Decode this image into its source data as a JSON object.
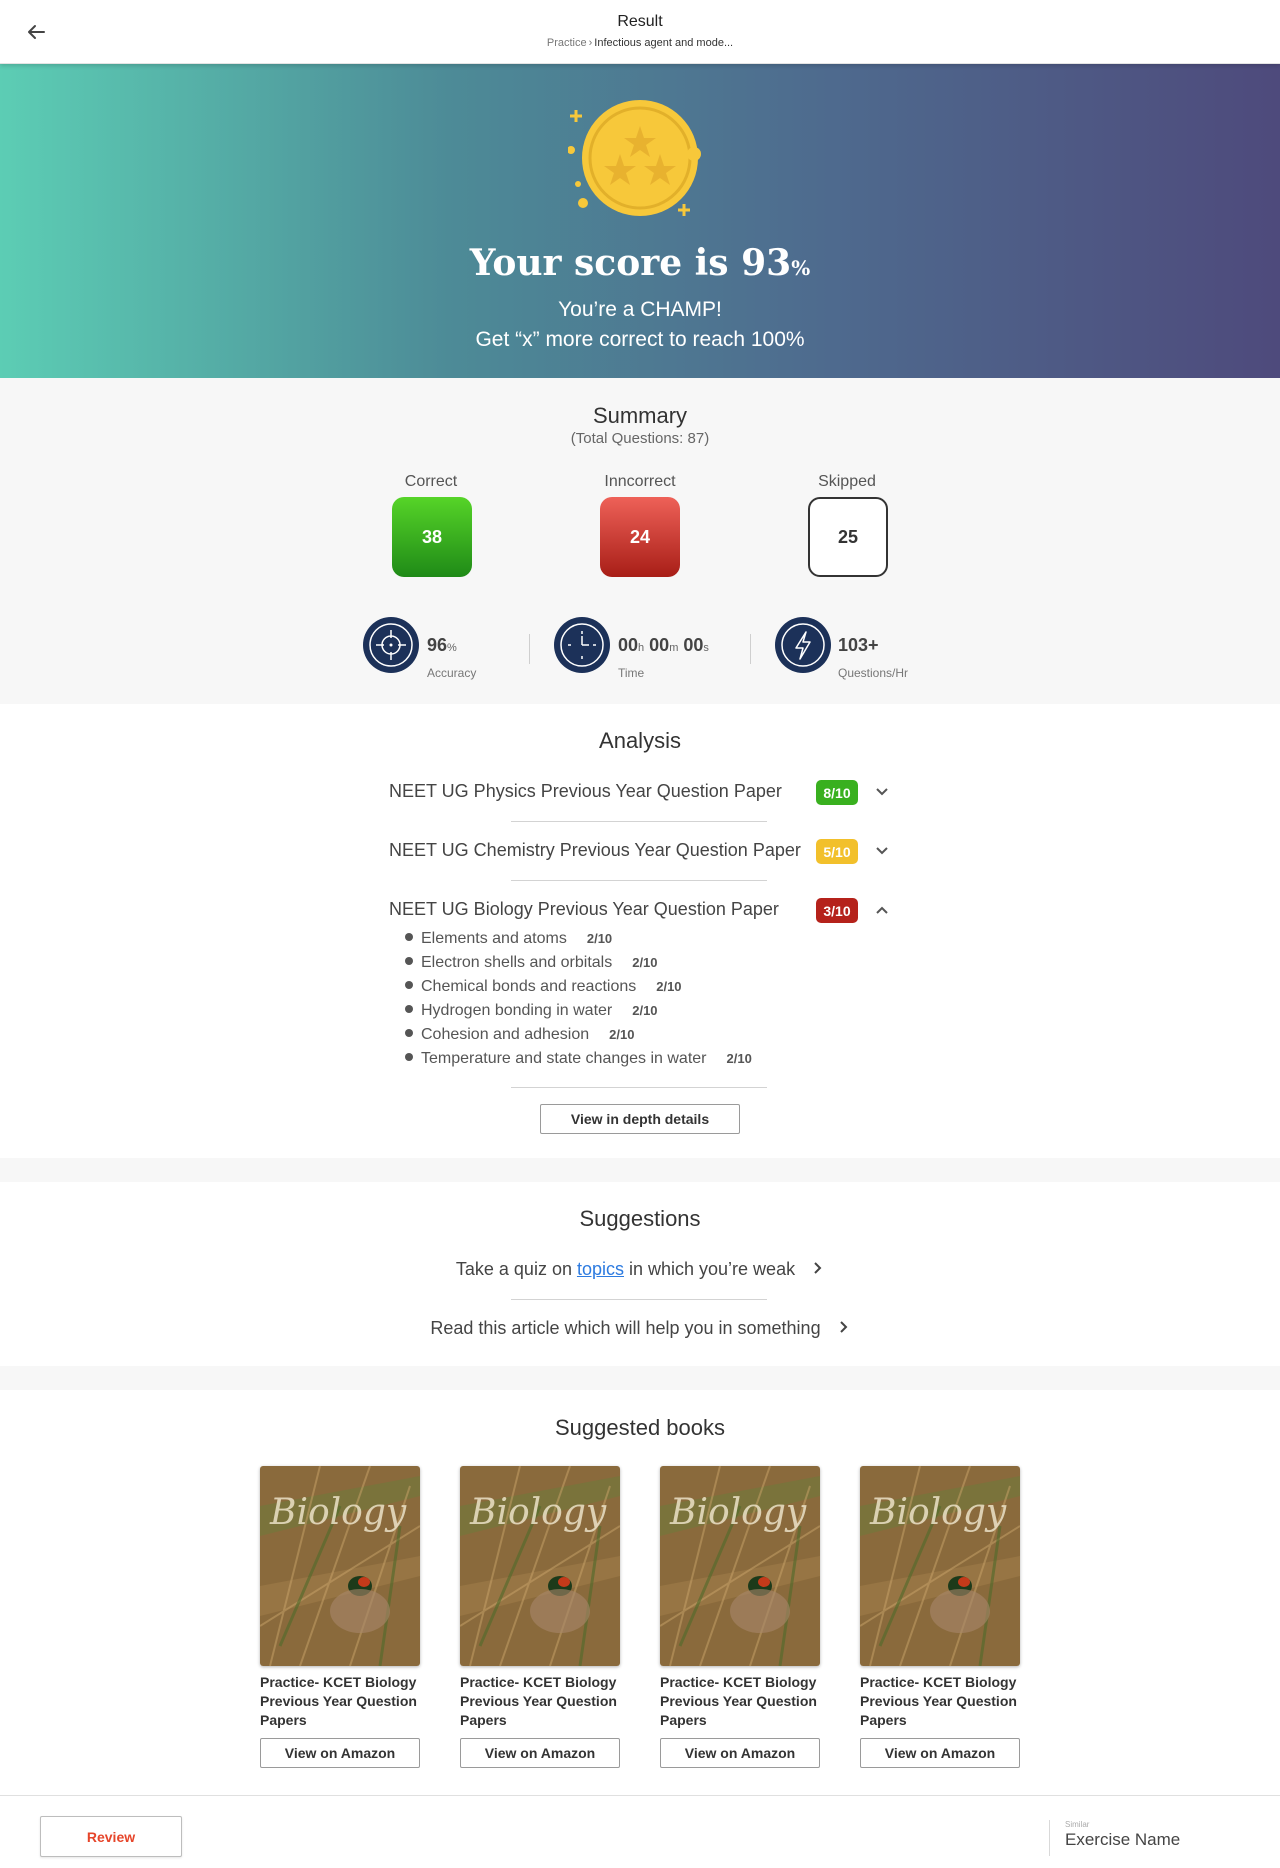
{
  "header": {
    "title": "Result",
    "breadcrumb_root": "Practice",
    "breadcrumb_separator": "›",
    "breadcrumb_current": "Infectious agent and mode..."
  },
  "hero": {
    "score_prefix": "Your score is ",
    "score_value": "93",
    "score_unit": "%",
    "message": "You’re a CHAMP!",
    "sub_message": "Get “x” more correct to reach 100%"
  },
  "summary": {
    "title": "Summary",
    "subtitle": "(Total Questions: 87)",
    "correct_label": "Correct",
    "correct_value": "38",
    "incorrect_label": "Inncorrect",
    "incorrect_value": "24",
    "skipped_label": "Skipped",
    "skipped_value": "25",
    "accuracy_value": "96",
    "accuracy_unit": "%",
    "accuracy_label": "Accuracy",
    "time_h": "00",
    "time_h_unit": "h",
    "time_m": "00",
    "time_m_unit": "m",
    "time_s": "00",
    "time_s_unit": "s",
    "time_label": "Time",
    "speed_value": "103+",
    "speed_label": "Questions/Hr"
  },
  "analysis": {
    "title": "Analysis",
    "rows": [
      {
        "label": "NEET UG Physics Previous Year Question Paper",
        "score": "8/10",
        "color": "#39b01f"
      },
      {
        "label": "NEET UG Chemistry Previous Year Question Paper",
        "score": "5/10",
        "color": "#f2c02b"
      },
      {
        "label": "NEET UG Biology Previous Year Question Paper",
        "score": "3/10",
        "color": "#b5221b"
      }
    ],
    "topics": [
      {
        "label": "Elements and atoms",
        "score": "2/10"
      },
      {
        "label": "Electron shells and orbitals",
        "score": "2/10"
      },
      {
        "label": "Chemical bonds and reactions",
        "score": "2/10"
      },
      {
        "label": "Hydrogen bonding in water",
        "score": "2/10"
      },
      {
        "label": "Cohesion and adhesion",
        "score": "2/10"
      },
      {
        "label": "Temperature and state changes in water",
        "score": "2/10"
      }
    ],
    "details_button": "View in depth details"
  },
  "suggestions": {
    "title": "Suggestions",
    "quiz_before": "Take a quiz on ",
    "quiz_link": "topics",
    "quiz_after": " in which you’re weak",
    "article": "Read this article which will help you in something"
  },
  "books": {
    "title": "Suggested books",
    "cover_word": "Biology",
    "items": [
      {
        "title": "Practice- KCET Biology Previous Year Question Papers",
        "button": "View on Amazon"
      },
      {
        "title": "Practice- KCET Biology Previous Year Question Papers",
        "button": "View on Amazon"
      },
      {
        "title": "Practice- KCET Biology Previous Year Question Papers",
        "button": "View on Amazon"
      },
      {
        "title": "Practice- KCET Biology Previous Year Question Papers",
        "button": "View on Amazon"
      }
    ]
  },
  "footer": {
    "review_button": "Review",
    "similar_label": "Similar",
    "exercise_name": "Exercise Name"
  },
  "colors": {
    "accent_coin": "#f7c83a",
    "navy": "#1c3159",
    "review_text": "#e6452a"
  }
}
